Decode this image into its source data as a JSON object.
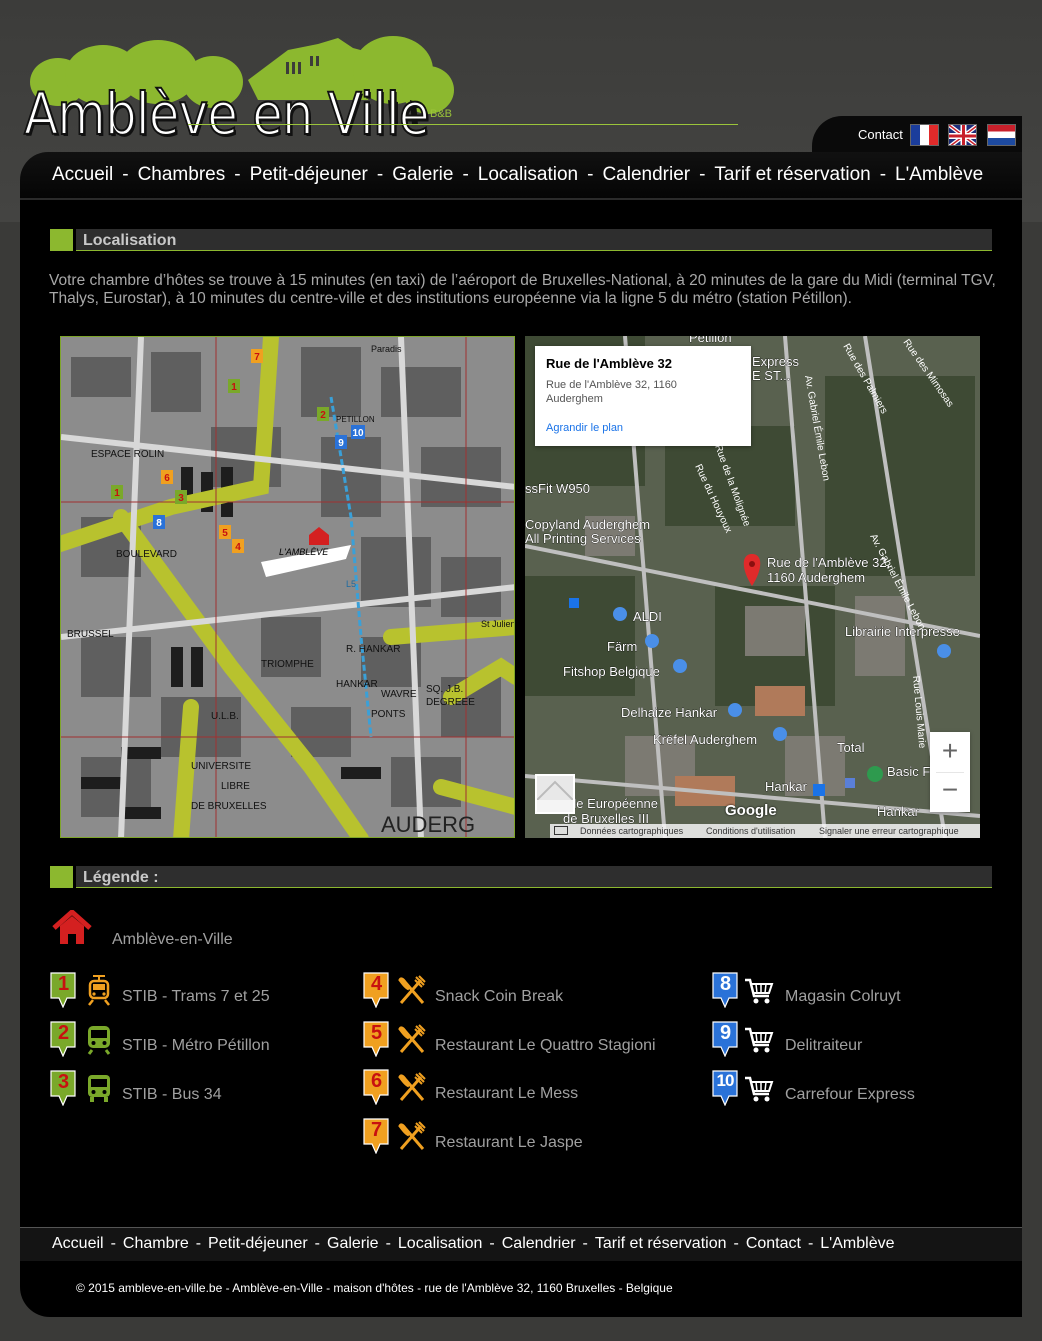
{
  "header": {
    "logo_text": "Amblève en Ville",
    "logo_suffix": "B&B",
    "contact_label": "Contact",
    "flags": [
      "fr",
      "en",
      "nl"
    ]
  },
  "nav": [
    "Accueil",
    "Chambres",
    "Petit-déjeuner",
    "Galerie",
    "Localisation",
    "Calendrier",
    "Tarif et réservation",
    "L'Amblève"
  ],
  "main": {
    "title": "Localisation",
    "intro": "Votre chambre d’hôtes se trouve à 15 minutes (en taxi) de l’aéroport de Bruxelles-National, à 20 minutes de la gare du Midi (terminal TGV, Thalys, Eurostar), à 10 minutes du centre-ville et des institutions européenne via la ligne 5 du métro (station Pétillon)."
  },
  "street_map": {
    "labels": [
      "ESPACE ROLIN",
      "L'AMBLÈVE",
      "BRUSSEL",
      "U.L.B.",
      "UNIVERSITE",
      "LIBRE",
      "DE BRUXELLES",
      "BOULEVARD",
      "TRIOMPHE",
      "R. HANKAR",
      "WAVRE",
      "SQ. J.B.",
      "DEGREEE",
      "PONTS",
      "AUDERG",
      "PETILLON",
      "HANKAR",
      "St Julien",
      "Paradis",
      "L5"
    ],
    "pins": [
      "1",
      "2",
      "3",
      "4",
      "5",
      "6",
      "7",
      "8",
      "9",
      "10"
    ]
  },
  "google_map": {
    "info_title": "Rue de l'Amblève 32",
    "info_address_1": "Rue de l'Amblève 32, 1160",
    "info_address_2": "Auderghem",
    "info_link": "Agrandir le plan",
    "marker_label_1": "Rue de l'Amblève 32,",
    "marker_label_2": "1160 Auderghem",
    "places": [
      "ALDI",
      "Färm",
      "Fitshop Belgique",
      "Delhaize Hankar",
      "Krëfel Auderghem",
      "Copyland Auderghem",
      "All Printing Services",
      "ssFit W950",
      "Librairie Interpresse",
      "Total",
      "Basic Fit",
      "Hankar",
      "Hankar",
      "École Européenne",
      "de Bruxelles III",
      "Pétillon",
      "Express",
      "E ST..."
    ],
    "streets": [
      "Rue de la Molignée",
      "Rue du Houyoux",
      "Av. Gabriel Émile Lebon",
      "Av. Gabriel Émile Lebon",
      "Rue des Palmiers",
      "Rue des Mimosas",
      "Rue Louis Marie"
    ],
    "footer_data": "Données cartographiques",
    "footer_terms": "Conditions d'utilisation",
    "footer_report": "Signaler une erreur cartographique",
    "google_logo": "Google"
  },
  "legend": {
    "title": "Légende :",
    "home_label": "Amblève-en-Ville",
    "transport": [
      {
        "num": "1",
        "label": "STIB - Trams 7 et 25",
        "icon": "tram-icon"
      },
      {
        "num": "2",
        "label": "STIB - Métro Pétillon",
        "icon": "metro-icon"
      },
      {
        "num": "3",
        "label": "STIB - Bus 34",
        "icon": "bus-icon"
      }
    ],
    "restaurants": [
      {
        "num": "4",
        "label": "Snack Coin Break",
        "icon": "fork-knife-icon"
      },
      {
        "num": "5",
        "label": "Restaurant Le Quattro Stagioni",
        "icon": "fork-knife-icon"
      },
      {
        "num": "6",
        "label": "Restaurant Le Mess",
        "icon": "fork-knife-icon"
      },
      {
        "num": "7",
        "label": "Restaurant Le Jaspe",
        "icon": "fork-knife-icon"
      }
    ],
    "shops": [
      {
        "num": "8",
        "label": "Magasin Colruyt",
        "icon": "cart-icon"
      },
      {
        "num": "9",
        "label": "Delitraiteur",
        "icon": "cart-icon"
      },
      {
        "num": "10",
        "label": "Carrefour Express",
        "icon": "cart-icon"
      }
    ]
  },
  "footer": {
    "nav": [
      "Accueil",
      "Chambre",
      "Petit-déjeuner",
      "Galerie",
      "Localisation",
      "Calendrier",
      "Tarif et réservation",
      "Contact",
      "L'Amblève"
    ],
    "copyright": "© 2015 ambleve-en-ville.be  -  Amblève-en-Ville  -  maison d'hôtes  -  rue de l'Amblève 32, 1160 Bruxelles  -  Belgique"
  },
  "colors": {
    "accent_green": "#8cb82f",
    "transport_pin": "#7aa82a",
    "restaurant_pin": "#f0a020",
    "shop_pin": "#2a72d8",
    "home_red": "#d42020"
  }
}
